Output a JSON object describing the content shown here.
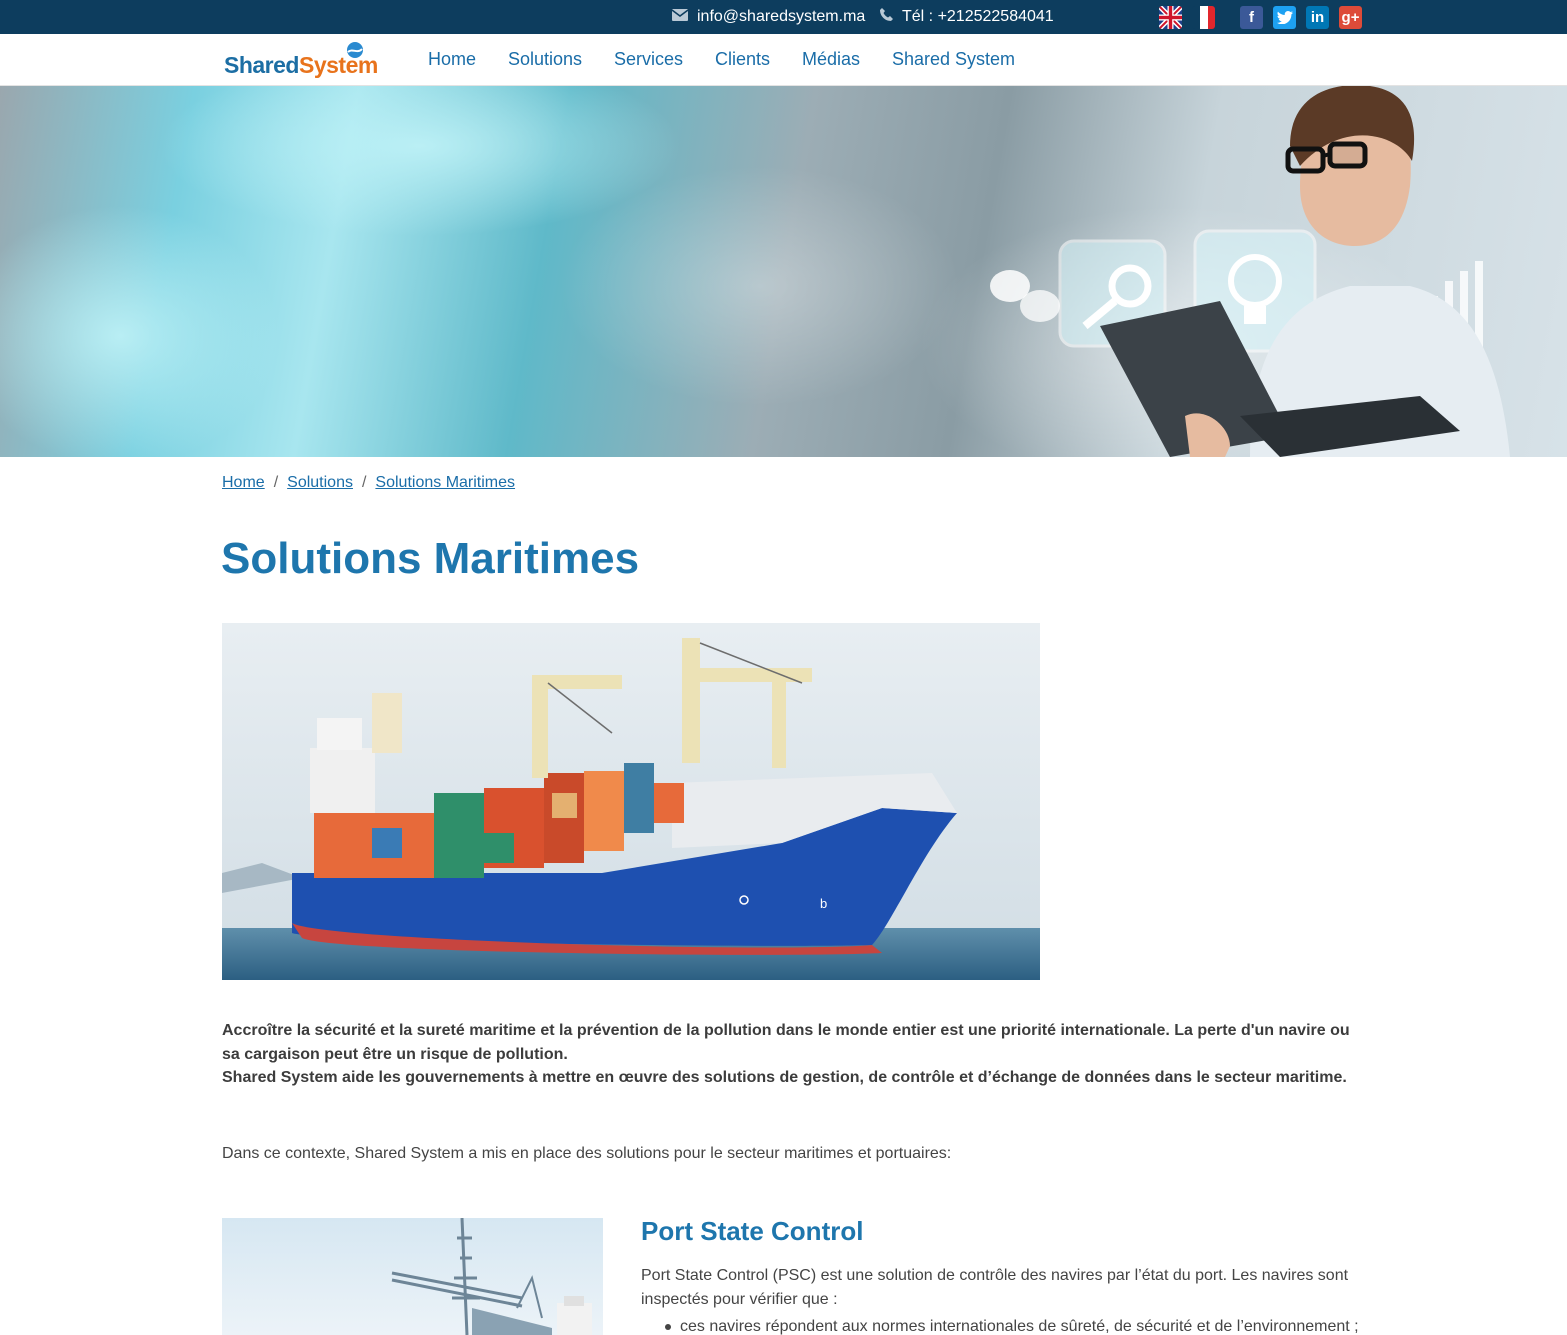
{
  "topbar": {
    "email": "info@sharedsystem.ma",
    "phone": "Tél : +212522584041",
    "email_icon": "envelope-icon",
    "phone_icon": "phone-icon",
    "languages": [
      "English",
      "Français"
    ],
    "social": {
      "facebook": "f",
      "twitter": "t",
      "linkedin": "in",
      "googleplus": "g+"
    }
  },
  "logo": {
    "part1": "Shared",
    "part2": "System"
  },
  "nav": {
    "items": [
      "Home",
      "Solutions",
      "Services",
      "Clients",
      "Médias",
      "Shared System"
    ]
  },
  "breadcrumb": [
    "Home",
    "Solutions",
    "Solutions Maritimes"
  ],
  "page": {
    "title": "Solutions Maritimes",
    "intro_line1": "Accroître la sécurité et la sureté maritime et la prévention de la pollution dans le monde entier est une priorité internationale. La perte d'un navire ou sa cargaison peut être un risque de pollution.",
    "intro_line2": "Shared System aide les gouvernements à mettre en œuvre des solutions de gestion, de contrôle et d’échange de données dans le secteur maritime.",
    "context": "Dans ce contexte, Shared System a mis en place des solutions pour le secteur maritimes et portuaires:"
  },
  "psc": {
    "title": "Port State Control",
    "desc": "Port State Control (PSC) est une solution de contrôle des navires par l’état du port. Les navires sont inspectés pour vérifier que :",
    "items": [
      "ces navires répondent aux normes internationales de sûreté, de sécurité et de l’environnement ;"
    ]
  },
  "colors": {
    "topbar": "#0d3d5e",
    "link": "#1a6da8",
    "title": "#1e76ad",
    "logo_blue": "#1c6ea4",
    "logo_orange": "#e8731c"
  }
}
